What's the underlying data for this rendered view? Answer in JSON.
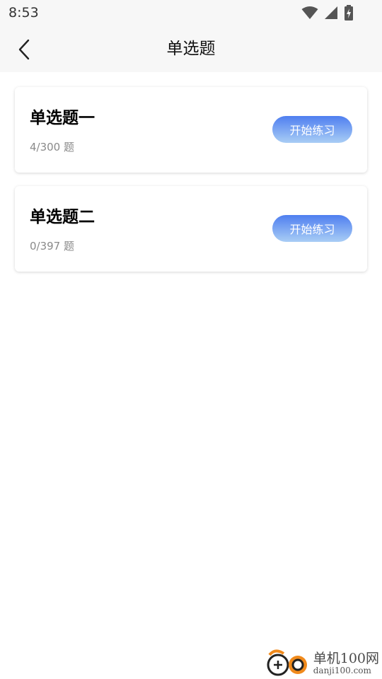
{
  "status_bar": {
    "time": "8:53",
    "icons": [
      "wifi-icon",
      "signal-icon",
      "battery-charging-icon"
    ]
  },
  "app_bar": {
    "title": "单选题",
    "back_icon": "chevron-left-icon"
  },
  "cards": [
    {
      "title": "单选题一",
      "progress": "4/300 题",
      "button_label": "开始练习"
    },
    {
      "title": "单选题二",
      "progress": "0/397 题",
      "button_label": "开始练习"
    }
  ],
  "colors": {
    "button_gradient_top": "#4f7ff0",
    "button_gradient_bottom": "#a9cdf5",
    "header_bg": "#f7f7f7",
    "watermark_orange": "#f08a1c"
  },
  "watermark": {
    "name": "单机100网",
    "url": "danji100.com"
  }
}
